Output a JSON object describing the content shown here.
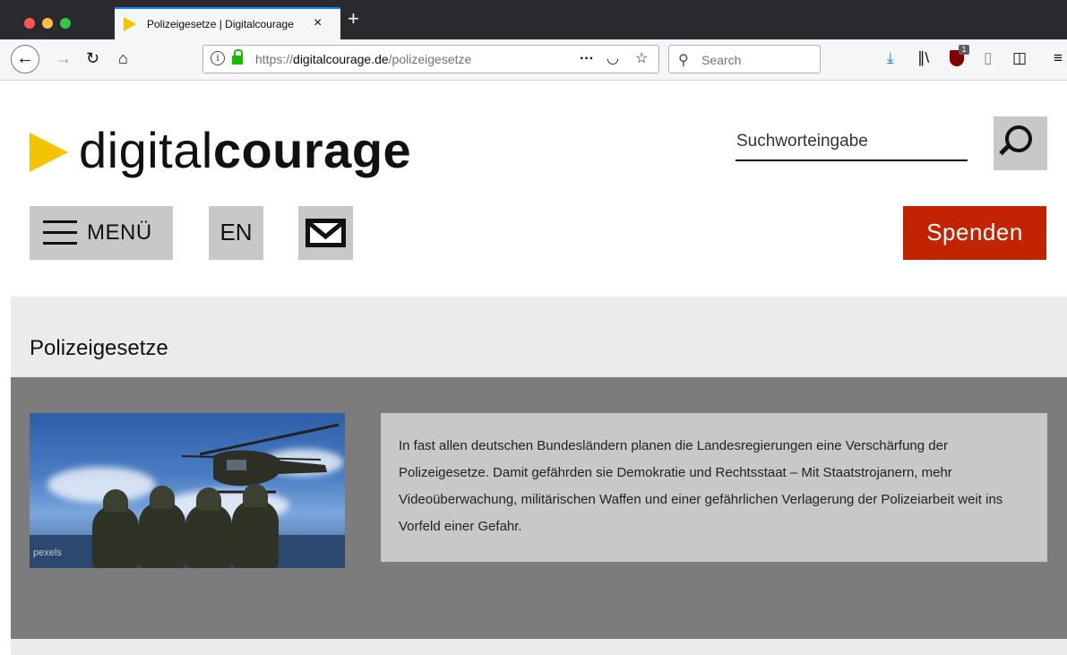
{
  "browser": {
    "tab_title": "Polizeigesetze | Digitalcourage",
    "tab_close": "×",
    "new_tab": "+",
    "url_prefix": "https://",
    "url_host": "digitalcourage.de",
    "url_path": "/polizeigesetze",
    "search_placeholder": "Search",
    "ublock_badge": "1"
  },
  "site": {
    "brand_light": "digital",
    "brand_bold": "courage",
    "search_placeholder": "Suchworteingabe",
    "menu_label": "MENÜ",
    "lang_label": "EN",
    "donate_label": "Spenden"
  },
  "page": {
    "title": "Polizeigesetze",
    "image_credit": "pexels",
    "intro": "In fast allen deutschen Bundesländern planen die Landesregierungen eine Verschärfung der Polizeigesetze. Damit gefährden sie Demokratie und Rechtsstaat – Mit Staatstrojanern, mehr Videoüberwachung, militärischen Waffen und einer gefährlichen Verlagerung der Polizeiarbeit weit ins Vorfeld einer Gefahr."
  },
  "colors": {
    "brand_yellow": "#f5c400",
    "donate_red": "#c32400",
    "button_gray": "#c8c8c8",
    "content_gray": "#7c7c7c",
    "band_light": "#ebebeb"
  },
  "icons": {
    "nav": [
      "back-arrow-icon",
      "forward-arrow-icon",
      "reload-icon",
      "home-icon"
    ],
    "url": [
      "info-icon",
      "lock-icon",
      "more-actions-icon",
      "pocket-icon",
      "bookmark-star-icon"
    ],
    "toolbar": [
      "download-icon",
      "library-icon",
      "ublock-icon",
      "reader-icon",
      "sidebar-icon",
      "hamburger-menu-icon"
    ],
    "site": [
      "search-icon",
      "menu-icon",
      "mail-icon"
    ]
  }
}
